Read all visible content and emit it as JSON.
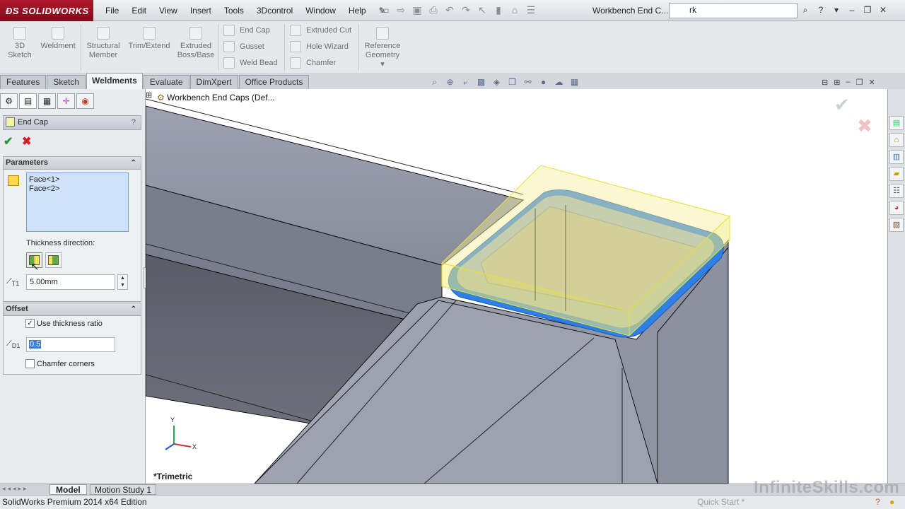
{
  "app": {
    "brand": "SOLIDWORKS",
    "doc_title": "Workbench End C...",
    "status": "SolidWorks Premium 2014 x64 Edition"
  },
  "menu": [
    "File",
    "Edit",
    "View",
    "Insert",
    "Tools",
    "3Dcontrol",
    "Window",
    "Help"
  ],
  "search": {
    "value": "rk"
  },
  "command_manager": {
    "big_buttons": [
      {
        "label_1": "3D",
        "label_2": "Sketch"
      },
      {
        "label_1": "Weldment",
        "label_2": ""
      },
      {
        "label_1": "Structural",
        "label_2": "Member"
      },
      {
        "label_1": "Trim/Extend",
        "label_2": ""
      },
      {
        "label_1": "Extruded",
        "label_2": "Boss/Base"
      }
    ],
    "small_col1": [
      "End Cap",
      "Gusset",
      "Weld Bead"
    ],
    "small_col2": [
      "Extruded Cut",
      "Hole Wizard",
      "Chamfer"
    ],
    "reference": {
      "label_1": "Reference",
      "label_2": "Geometry"
    }
  },
  "tabs": [
    "Features",
    "Sketch",
    "Weldments",
    "Evaluate",
    "DimXpert",
    "Office Products"
  ],
  "active_tab": "Weldments",
  "property_manager": {
    "title": "End Cap",
    "help": "?",
    "parameters": {
      "header": "Parameters",
      "faces": [
        "Face<1>",
        "Face<2>"
      ],
      "thickness_direction_label": "Thickness direction:",
      "thickness_value": "5.00mm",
      "thickness_symbol": "T1"
    },
    "offset": {
      "header": "Offset",
      "use_thickness_ratio_label": "Use thickness ratio",
      "use_thickness_ratio_checked": true,
      "offset_value": "0.5",
      "offset_symbol": "D1",
      "chamfer_corners_label": "Chamfer corners",
      "chamfer_corners_checked": false
    }
  },
  "viewport": {
    "tree_label": "Workbench End Caps  (Def...",
    "view_name": "*Trimetric",
    "axis_labels": {
      "x": "X",
      "y": "Y"
    }
  },
  "bottom_tabs": [
    "Model",
    "Motion Study 1"
  ],
  "status_right": "Quick Start *",
  "watermark": "InfiniteSkills.com",
  "colors": {
    "accent": "#b3172c",
    "selection_blue": "#2f7fe0",
    "preview_yellow": "#f5f27a"
  }
}
